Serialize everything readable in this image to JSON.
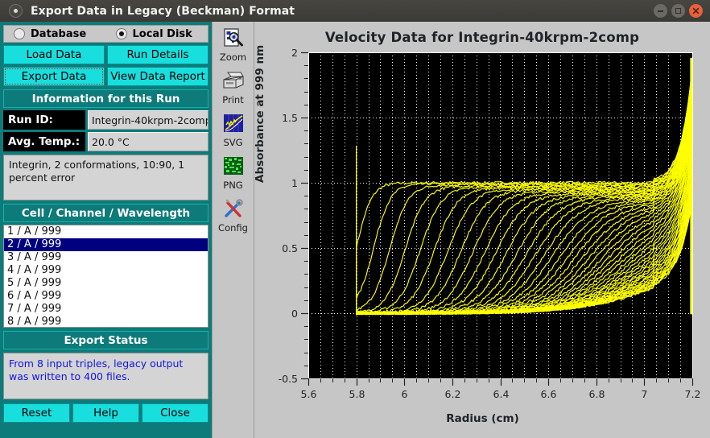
{
  "window": {
    "title": "Export Data in Legacy (Beckman) Format",
    "buttons": {
      "minimize": "–",
      "maximize": "□",
      "close": "×"
    },
    "accent_teal": "#0d7b79",
    "accent_cyan": "#18dede"
  },
  "source": {
    "options": [
      {
        "label": "Database",
        "selected": false
      },
      {
        "label": "Local Disk",
        "selected": true
      }
    ]
  },
  "actions": [
    {
      "label": "Load Data",
      "focused": false
    },
    {
      "label": "Run Details",
      "focused": false
    },
    {
      "label": "Export Data",
      "focused": true
    },
    {
      "label": "View Data Report",
      "focused": false
    }
  ],
  "run_info": {
    "header": "Information for this Run",
    "fields": [
      {
        "label": "Run ID:",
        "value": "Integrin-40krpm-2comp"
      },
      {
        "label": "Avg. Temp.:",
        "value": "20.0 °C"
      }
    ],
    "notes": "Integrin, 2 conformations, 10:90, 1 percent error"
  },
  "triples": {
    "header": "Cell / Channel / Wavelength",
    "items": [
      {
        "label": "1 / A / 999",
        "selected": false
      },
      {
        "label": "2 / A / 999",
        "selected": true
      },
      {
        "label": "3 / A / 999",
        "selected": false
      },
      {
        "label": "4 / A / 999",
        "selected": false
      },
      {
        "label": "5 / A / 999",
        "selected": false
      },
      {
        "label": "6 / A / 999",
        "selected": false
      },
      {
        "label": "7 / A / 999",
        "selected": false
      },
      {
        "label": "8 / A / 999",
        "selected": false
      }
    ]
  },
  "export_status": {
    "header": "Export Status",
    "message": "From 8 input triples, legacy output was written to 400 files."
  },
  "footer": {
    "buttons": [
      {
        "label": "Reset"
      },
      {
        "label": "Help"
      },
      {
        "label": "Close"
      }
    ]
  },
  "toolstrip": {
    "items": [
      {
        "icon": "zoom-icon",
        "label": "Zoom"
      },
      {
        "icon": "print-icon",
        "label": "Print"
      },
      {
        "icon": "svg-icon",
        "label": "SVG"
      },
      {
        "icon": "png-icon",
        "label": "PNG"
      },
      {
        "icon": "config-icon",
        "label": "Config"
      }
    ]
  },
  "chart_data": {
    "type": "line",
    "title": "Velocity Data for Integrin-40krpm-2comp",
    "xlabel": "Radius (cm)",
    "ylabel": "Absorbance at 999 nm",
    "xlim": [
      5.6,
      7.2
    ],
    "ylim": [
      -0.5,
      2.0
    ],
    "xticks": [
      5.6,
      5.8,
      6,
      6.2,
      6.4,
      6.6,
      6.8,
      7,
      7.2
    ],
    "xticklabels": [
      "5.6",
      "5.8",
      "6",
      "6.2",
      "6.4",
      "6.6",
      "6.8",
      "7",
      "7.2"
    ],
    "yticks": [
      -0.5,
      0,
      0.5,
      1,
      1.5,
      2
    ],
    "yticklabels": [
      "-0.5",
      "0",
      "0.5",
      "1",
      "1.5",
      "2"
    ],
    "x_minor_step": 0.05,
    "y_minor_step": 0.1,
    "grid": true,
    "grid_style": "dotted",
    "grid_color": "#ffffff",
    "plot_bg": "#000000",
    "series_color": "#ffff00",
    "legend": "none",
    "n_scans": 50,
    "meniscus": 5.8,
    "bottom": 7.2,
    "meniscus_spike_height": 1.28,
    "bottom_spike_height": 1.95,
    "plateau_start": 1.0,
    "plateau_end": 0.62,
    "baseline": 0.0,
    "noise_pct": 1.0,
    "description": "Sedimentation velocity boundaries: 50 scans of a 2-component integrin sample at 40 krpm. Boundaries start at the meniscus (5.8 cm) with a plateau near 1.0 AU and migrate toward the cell bottom (7.2 cm) while the plateau decays to about 0.62 AU."
  }
}
